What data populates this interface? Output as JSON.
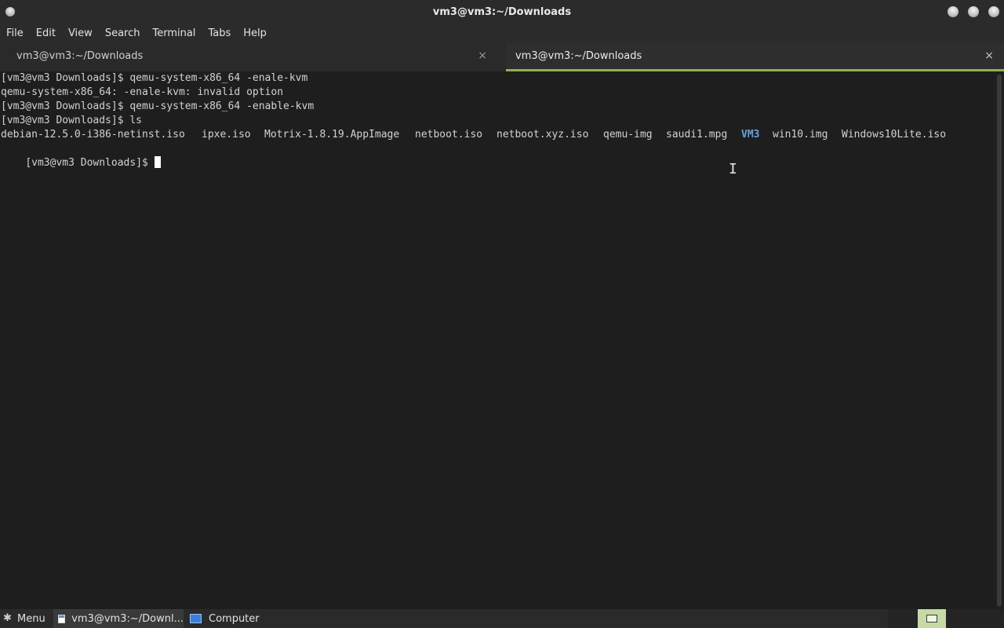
{
  "window": {
    "title": "vm3@vm3:~/Downloads"
  },
  "menubar": {
    "items": [
      "File",
      "Edit",
      "View",
      "Search",
      "Terminal",
      "Tabs",
      "Help"
    ]
  },
  "tabs": [
    {
      "label": "vm3@vm3:~/Downloads",
      "close": "×",
      "active": false
    },
    {
      "label": "vm3@vm3:~/Downloads",
      "close": "×",
      "active": true
    }
  ],
  "terminal": {
    "lines": [
      "[vm3@vm3 Downloads]$ qemu-system-x86_64 -enale-kvm",
      "qemu-system-x86_64: -enale-kvm: invalid option",
      "[vm3@vm3 Downloads]$ qemu-system-x86_64 -enable-kvm",
      "[vm3@vm3 Downloads]$ ls"
    ],
    "ls_entries": [
      {
        "name": "debian-12.5.0-i386-netinst.iso",
        "type": "file"
      },
      {
        "name": "ipxe.iso",
        "type": "file"
      },
      {
        "name": "Motrix-1.8.19.AppImage",
        "type": "file"
      },
      {
        "name": "netboot.iso",
        "type": "file"
      },
      {
        "name": "netboot.xyz.iso",
        "type": "file"
      },
      {
        "name": "qemu-img",
        "type": "file"
      },
      {
        "name": "saudi1.mpg",
        "type": "file"
      },
      {
        "name": "VM3",
        "type": "directory"
      },
      {
        "name": "win10.img",
        "type": "file"
      },
      {
        "name": "Windows10Lite.iso",
        "type": "file"
      }
    ],
    "prompt": "[vm3@vm3 Downloads]$",
    "colors": {
      "directory": "#6aa0d8",
      "text": "#d2d2d2",
      "background": "#1e1e1e"
    }
  },
  "taskbar": {
    "menu_label": "Menu",
    "terminal_task": "vm3@vm3:~/Downl...",
    "computer_label": "Computer"
  },
  "accent": "#8ab44e"
}
